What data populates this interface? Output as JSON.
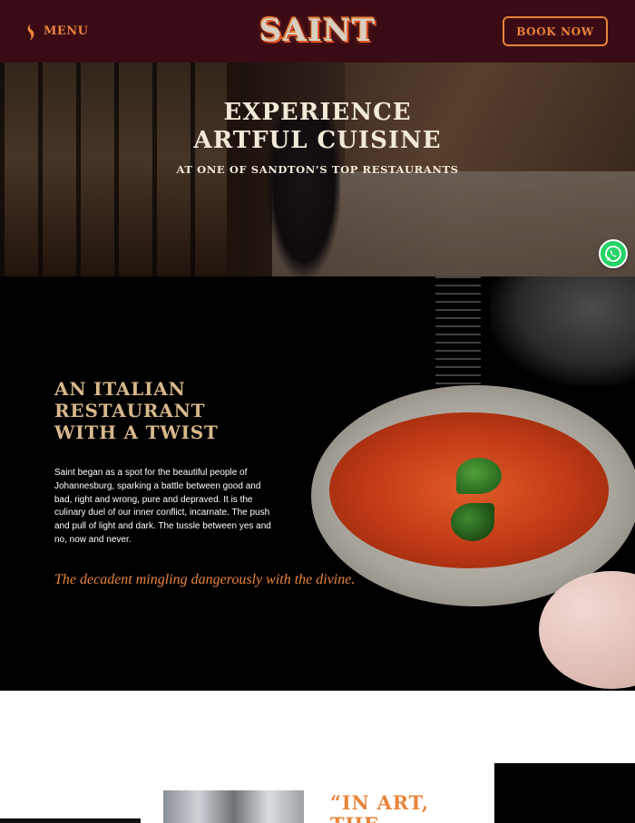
{
  "header": {
    "menu_label": "MENU",
    "logo_text": "SAINT",
    "book_label": "BOOK NOW"
  },
  "hero": {
    "title_line1": "EXPERIENCE",
    "title_line2": "ARTFUL CUISINE",
    "subtitle": "AT ONE OF SANDTON’S TOP RESTAURANTS"
  },
  "intro": {
    "heading_line1": "AN ITALIAN",
    "heading_line2": "RESTAURANT",
    "heading_line3": "WITH A TWIST",
    "body": "Saint began as a spot for the beautiful people of Johannesburg, sparking a battle between good and bad, right and wrong, pure and depraved. It is the culinary duel of our inner conflict, incarnate. The push and pull of light and dark. The tussle between yes and no, now and never.",
    "quote": "The decadent mingling dangerously with the divine."
  },
  "bottom": {
    "quote_line1": "“IN ART,",
    "quote_line2": "THE"
  },
  "icons": {
    "menu": "flame-s-icon",
    "whatsapp": "whatsapp-icon"
  },
  "colors": {
    "header_bg": "#3a0b14",
    "accent": "#e8843a",
    "gold": "#d7b88a",
    "whatsapp_green": "#25d366"
  }
}
